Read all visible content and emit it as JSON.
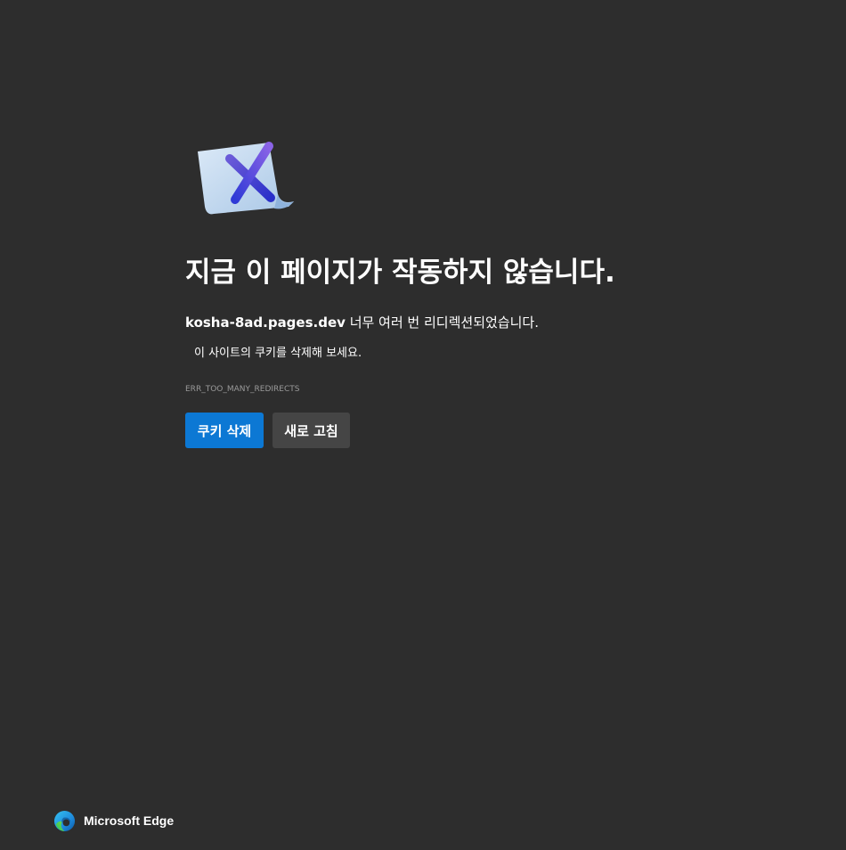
{
  "error": {
    "title": "지금 이 페이지가 작동하지 않습니다.",
    "domain": "kosha-8ad.pages.dev",
    "message_suffix": " 너무 여러 번 리디렉션되었습니다.",
    "suggestion": "이 사이트의 쿠키를 삭제해 보세요.",
    "code": "ERR_TOO_MANY_REDIRECTS"
  },
  "buttons": {
    "clear_cookies_label": "쿠키 삭제",
    "reload_label": "새로 고침"
  },
  "footer": {
    "brand_name": "Microsoft Edge",
    "brand_icon": "edge-logo-icon"
  },
  "colors": {
    "background": "#2d2d2d",
    "primary_button": "#0c78d4",
    "secondary_button": "#454545",
    "error_code_text": "#9a9a9a"
  }
}
